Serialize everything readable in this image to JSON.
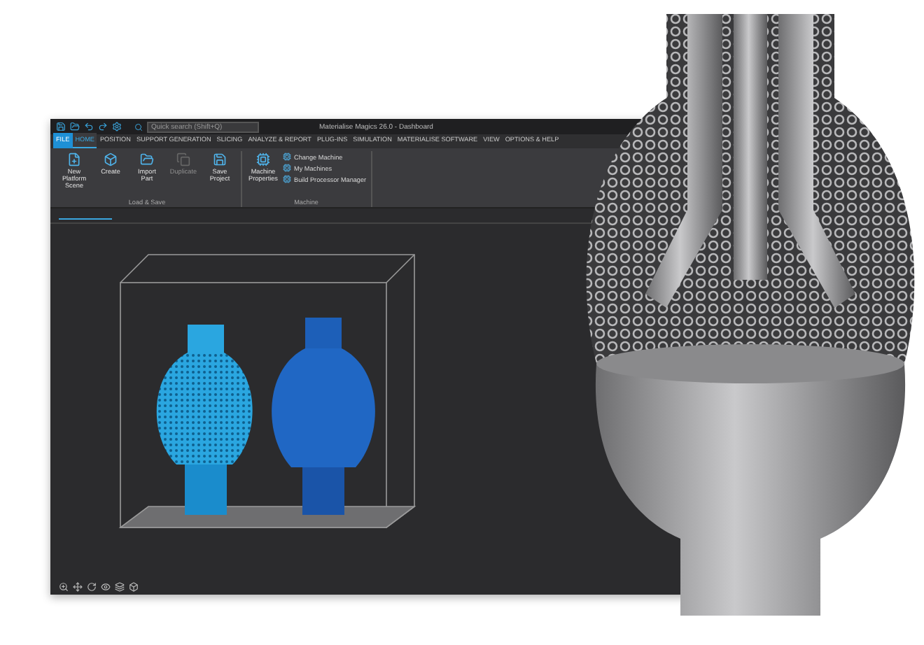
{
  "window": {
    "title": "Materialise Magics 26.0 - Dashboard"
  },
  "quick_access": {
    "search": {
      "placeholder": "Quick search (Shift+Q)"
    }
  },
  "tabs": [
    {
      "label": "FILE",
      "kind": "file",
      "selected": false
    },
    {
      "label": "HOME",
      "kind": "tab",
      "selected": true
    },
    {
      "label": "POSITION",
      "kind": "tab",
      "selected": false
    },
    {
      "label": "SUPPORT GENERATION",
      "kind": "tab",
      "selected": false
    },
    {
      "label": "SLICING",
      "kind": "tab",
      "selected": false
    },
    {
      "label": "ANALYZE & REPORT",
      "kind": "tab",
      "selected": false
    },
    {
      "label": "PLUG-INS",
      "kind": "tab",
      "selected": false
    },
    {
      "label": "SIMULATION",
      "kind": "tab",
      "selected": false
    },
    {
      "label": "MATERIALISE SOFTWARE",
      "kind": "tab",
      "selected": false
    },
    {
      "label": "VIEW",
      "kind": "tab",
      "selected": false
    },
    {
      "label": "OPTIONS & HELP",
      "kind": "tab",
      "selected": false
    }
  ],
  "ribbon": {
    "groups": [
      {
        "label": "Load & Save",
        "buttons": [
          {
            "label": "New Platform Scene",
            "kind": "large",
            "disabled": false
          },
          {
            "label": "Create",
            "kind": "large",
            "disabled": false
          },
          {
            "label": "Import Part",
            "kind": "large",
            "disabled": false
          },
          {
            "label": "Duplicate",
            "kind": "large",
            "disabled": true
          },
          {
            "label": "Save Project",
            "kind": "large",
            "disabled": false
          }
        ]
      },
      {
        "label": "Machine",
        "buttons": [
          {
            "label": "Machine Properties",
            "kind": "large",
            "disabled": false
          },
          {
            "label": "Change Machine",
            "kind": "small",
            "disabled": false
          },
          {
            "label": "My Machines",
            "kind": "small",
            "disabled": false
          },
          {
            "label": "Build Processor Manager",
            "kind": "small",
            "disabled": false
          }
        ]
      }
    ]
  }
}
